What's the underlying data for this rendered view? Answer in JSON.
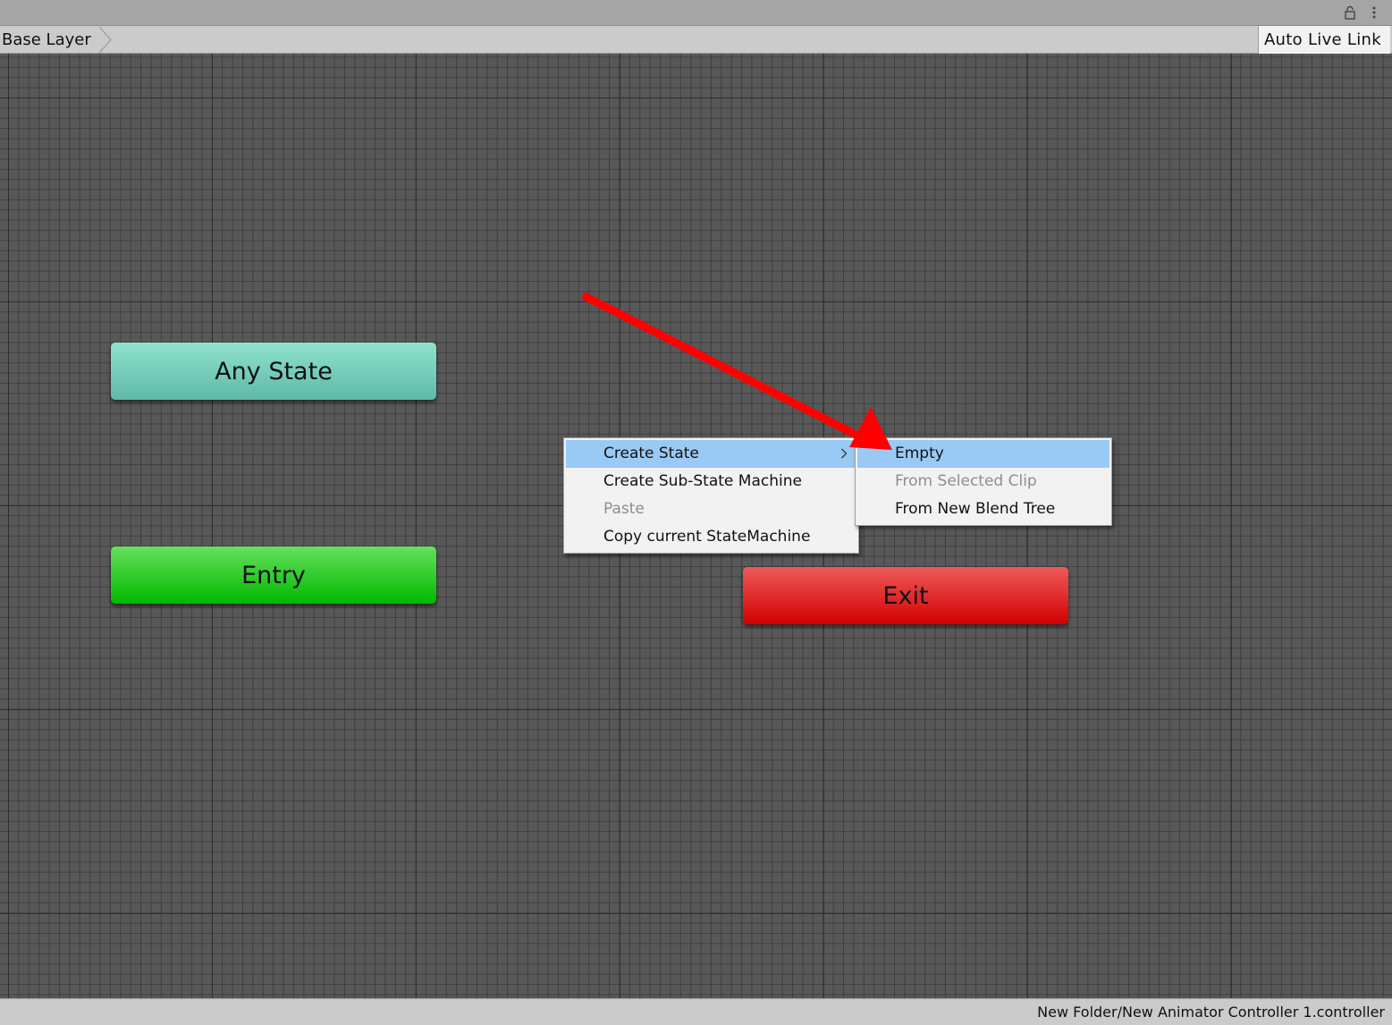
{
  "toolbar": {
    "breadcrumb": "Base Layer",
    "live_link_label": "Auto Live Link"
  },
  "nodes": {
    "any_state": "Any State",
    "entry": "Entry",
    "exit": "Exit"
  },
  "context_menu": {
    "items": [
      {
        "label": "Create State",
        "highlighted": true,
        "has_submenu": true
      },
      {
        "label": "Create Sub-State Machine"
      },
      {
        "label": "Paste",
        "disabled": true
      },
      {
        "label": "Copy current StateMachine"
      }
    ]
  },
  "submenu": {
    "items": [
      {
        "label": "Empty",
        "highlighted": true
      },
      {
        "label": "From Selected Clip",
        "disabled": true
      },
      {
        "label": "From New Blend Tree"
      }
    ]
  },
  "statusbar": {
    "path": "New Folder/New Animator Controller 1.controller"
  },
  "colors": {
    "highlight": "#99c9f5",
    "annotation_arrow": "#ff0000",
    "any_state": "#6fc9b6",
    "entry": "#14c40f",
    "exit": "#e01010"
  }
}
